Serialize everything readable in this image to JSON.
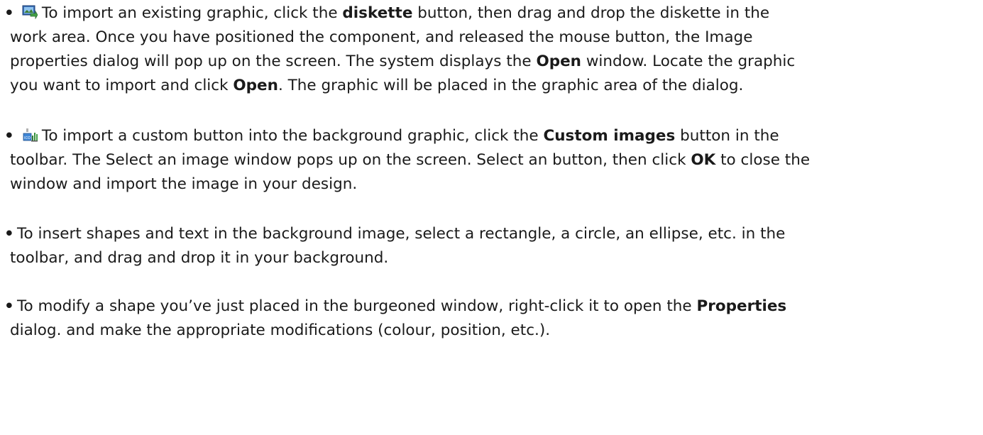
{
  "items": [
    {
      "icon": "import-graphic-icon",
      "t1": "To import an existing graphic, click the ",
      "b1": "diskette",
      "t2": " button, then drag and drop the diskette in the",
      "l2": "work area. Once you have positioned the component, and released the mouse button, the Image",
      "l3a": "properties dialog will pop up on the screen. The system displays the ",
      "l3b": "Open",
      "l3c": " window. Locate the graphic",
      "l4a": "you want to import and click ",
      "l4b": "Open",
      "l4c": ". The graphic will be placed in the graphic area of the dialog."
    },
    {
      "icon": "custom-images-icon",
      "t1": "To import a custom button into the background graphic, click the ",
      "b1": "Custom images",
      "t2": " button in the",
      "l2a": "toolbar. The Select an image window pops up on the screen. Select an button, then click ",
      "l2b": "OK",
      "l2c": " to close the",
      "l3": "window and import the image in your design."
    },
    {
      "l1": "To insert shapes and text in the background image, select a rectangle, a circle, an ellipse, etc. in the",
      "l2": "toolbar, and drag and drop it in your background."
    },
    {
      "l1a": "To modify a shape you’ve just placed in the burgeoned window, right-click it to open the ",
      "l1b": "Properties",
      "l2": "dialog. and make the appropriate modifications (colour, position, etc.)."
    }
  ],
  "bullet": "•"
}
